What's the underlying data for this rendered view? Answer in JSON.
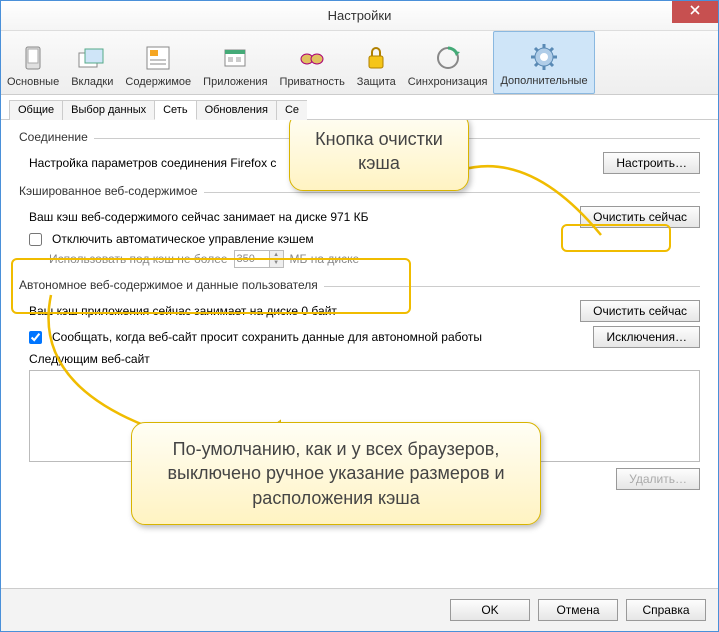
{
  "window": {
    "title": "Настройки"
  },
  "toolbar": {
    "items": [
      {
        "label": "Основные"
      },
      {
        "label": "Вкладки"
      },
      {
        "label": "Содержимое"
      },
      {
        "label": "Приложения"
      },
      {
        "label": "Приватность"
      },
      {
        "label": "Защита"
      },
      {
        "label": "Синхронизация"
      },
      {
        "label": "Дополнительные"
      }
    ]
  },
  "tabs": {
    "items": [
      {
        "label": "Общие"
      },
      {
        "label": "Выбор данных"
      },
      {
        "label": "Сеть"
      },
      {
        "label": "Обновления"
      },
      {
        "label": "Се"
      }
    ]
  },
  "groups": {
    "connection": {
      "title": "Соединение",
      "desc": "Настройка параметров соединения Firefox с",
      "configure_btn": "Настроить…"
    },
    "cache": {
      "title": "Кэшированное веб-содержимое",
      "status": "Ваш кэш веб-содержимого сейчас занимает на диске 971 КБ",
      "clear_btn": "Очистить сейчас",
      "disable_auto": "Отключить автоматическое управление кэшем",
      "use_max_prefix": "Использовать под кэш не более",
      "size_value": "350",
      "size_suffix": "МБ на диске"
    },
    "offline": {
      "title": "Автономное веб-содержимое и данные пользователя",
      "status": "Ваш кэш приложения сейчас занимает на диске 0 байт",
      "clear_btn": "Очистить сейчас",
      "notify": "Сообщать, когда веб-сайт просит сохранить данные для автономной работы",
      "exceptions_btn": "Исключения…",
      "list_label": "Следующим веб-сайт",
      "delete_btn": "Удалить…"
    }
  },
  "footer": {
    "ok": "OK",
    "cancel": "Отмена",
    "help": "Справка"
  },
  "callouts": {
    "top": "Кнопка очистки кэша",
    "bottom": "По-умолчанию, как и у всех браузеров, выключено ручное указание размеров и расположения кэша"
  }
}
